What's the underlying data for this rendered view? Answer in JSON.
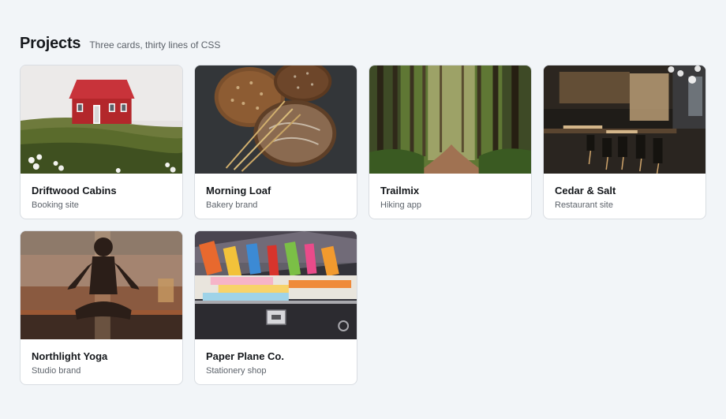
{
  "header": {
    "title": "Projects",
    "subtitle": "Three cards, thirty lines of CSS"
  },
  "cards": [
    {
      "name": "Driftwood Cabins",
      "type": "Booking site",
      "image": "red-cabin-on-hill-photo"
    },
    {
      "name": "Morning Loaf",
      "type": "Bakery brand",
      "image": "bread-loaves-photo"
    },
    {
      "name": "Trailmix",
      "type": "Hiking app",
      "image": "forest-path-photo"
    },
    {
      "name": "Cedar & Salt",
      "type": "Restaurant site",
      "image": "restaurant-interior-photo"
    },
    {
      "name": "Northlight Yoga",
      "type": "Studio brand",
      "image": "yoga-silhouette-photo"
    },
    {
      "name": "Paper Plane Co.",
      "type": "Stationery shop",
      "image": "stationery-box-photo"
    }
  ]
}
